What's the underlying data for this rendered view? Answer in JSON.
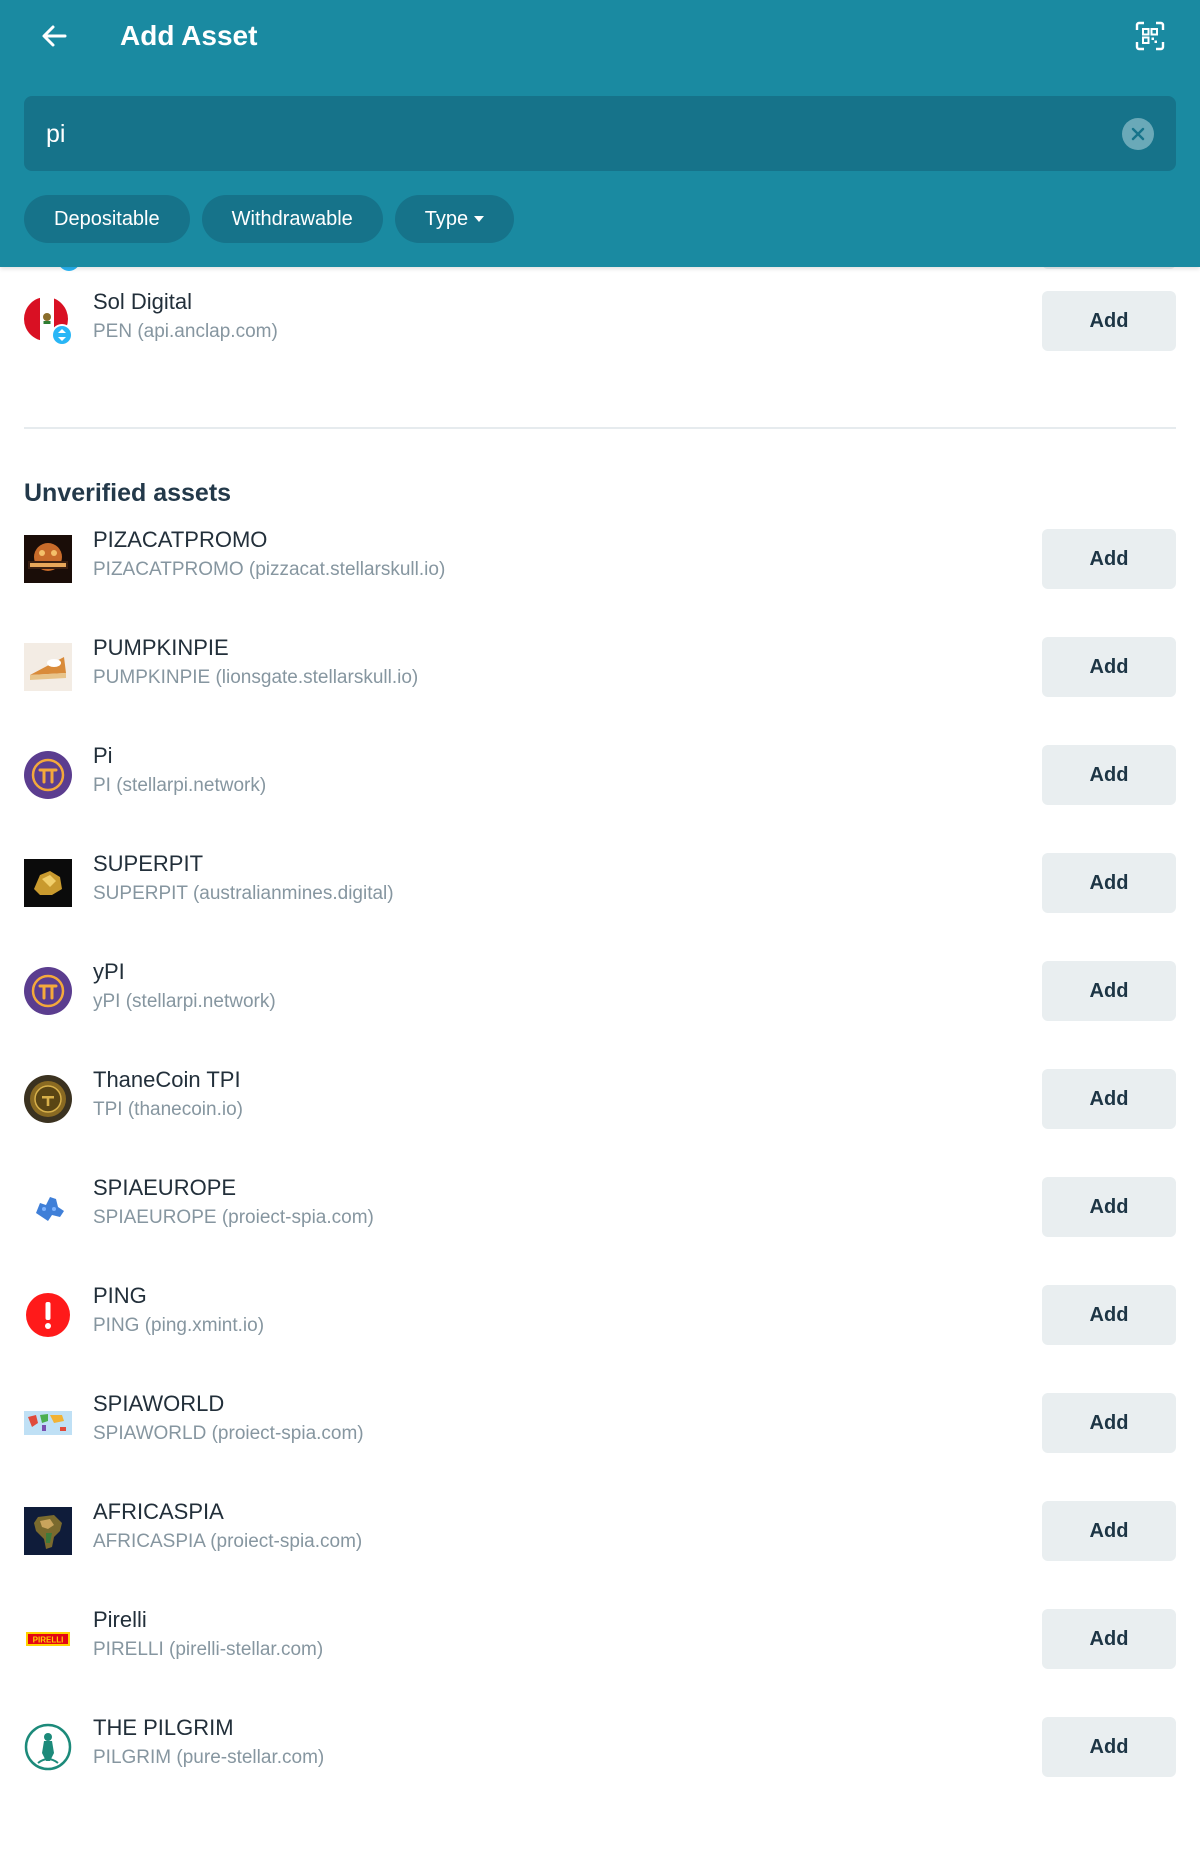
{
  "header": {
    "title": "Add Asset",
    "back_icon": "arrow-left-icon",
    "scan_icon": "qr-scan-icon",
    "background": "#1a8aa1"
  },
  "search": {
    "value": "pi",
    "clear_icon": "clear-circle-icon"
  },
  "filters": [
    {
      "label": "Depositable"
    },
    {
      "label": "Withdrawable"
    },
    {
      "label": "Type",
      "icon": "caret-down-icon"
    }
  ],
  "verified_items": [
    {
      "name": "Sol Digital",
      "sub": "PEN (api.anclap.com)",
      "add_label": "Add",
      "icon": "peru-flag-icon"
    }
  ],
  "unverified": {
    "title": "Unverified assets",
    "items": [
      {
        "name": "PIZACATPROMO",
        "sub": "PIZACATPROMO (pizzacat.stellarskull.io)",
        "add_label": "Add",
        "icon": "pizzacat-promo-icon"
      },
      {
        "name": "PUMPKINPIE",
        "sub": "PUMPKINPIE (lionsgate.stellarskull.io)",
        "add_label": "Add",
        "icon": "pumpkin-pie-icon"
      },
      {
        "name": "Pi",
        "sub": "PI (stellarpi.network)",
        "add_label": "Add",
        "icon": "pi-coin-icon"
      },
      {
        "name": "SUPERPIT",
        "sub": "SUPERPIT (australianmines.digital)",
        "add_label": "Add",
        "icon": "gold-nugget-icon"
      },
      {
        "name": "yPI",
        "sub": "yPI (stellarpi.network)",
        "add_label": "Add",
        "icon": "pi-coin-icon"
      },
      {
        "name": "ThaneCoin TPI",
        "sub": "TPI (thanecoin.io)",
        "add_label": "Add",
        "icon": "thanecoin-icon"
      },
      {
        "name": "SPIAEUROPE",
        "sub": "SPIAEUROPE (proiect-spia.com)",
        "add_label": "Add",
        "icon": "europe-map-icon"
      },
      {
        "name": "PING",
        "sub": "PING (ping.xmint.io)",
        "add_label": "Add",
        "icon": "exclamation-icon"
      },
      {
        "name": "SPIAWORLD",
        "sub": "SPIAWORLD (proiect-spia.com)",
        "add_label": "Add",
        "icon": "world-map-icon"
      },
      {
        "name": "AFRICASPIA",
        "sub": "AFRICASPIA (proiect-spia.com)",
        "add_label": "Add",
        "icon": "africa-map-icon"
      },
      {
        "name": "Pirelli",
        "sub": "PIRELLI (pirelli-stellar.com)",
        "add_label": "Add",
        "icon": "pirelli-logo-icon",
        "logo_text": "PIRELLI"
      },
      {
        "name": "THE PILGRIM",
        "sub": "PILGRIM (pure-stellar.com)",
        "add_label": "Add",
        "icon": "pilgrim-icon"
      }
    ]
  }
}
